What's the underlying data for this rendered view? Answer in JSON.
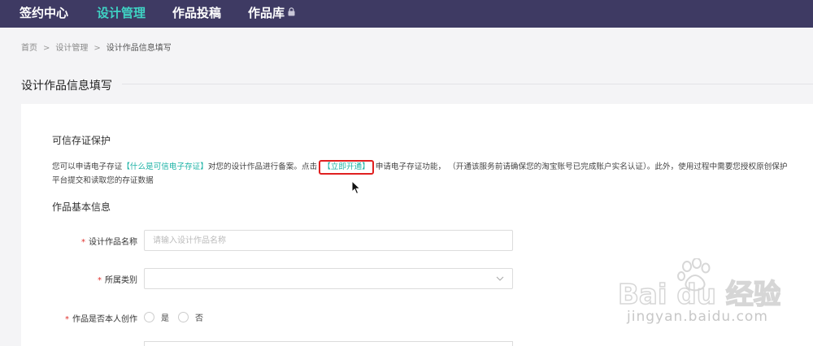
{
  "nav": {
    "items": [
      {
        "label": "签约中心"
      },
      {
        "label": "设计管理"
      },
      {
        "label": "作品投稿"
      },
      {
        "label": "作品库"
      }
    ]
  },
  "breadcrumb": {
    "items": [
      "首页",
      "设计管理",
      "设计作品信息填写"
    ],
    "separator": ">"
  },
  "page": {
    "title": "设计作品信息填写"
  },
  "trust": {
    "title": "可信存证保护",
    "text_1": "您可以申请电子存证",
    "link_what": "【什么是可信电子存证】",
    "text_2": "对您的设计作品进行备案。点击",
    "link_open": "【立即开通】",
    "text_3": "申请电子存证功能，  （开通该服务前请确保您的淘宝账号已完成账户实名认证）。此外，使用过程中需要您授权原创保护平台提交和读取您的存证数据"
  },
  "basic_info": {
    "title": "作品基本信息",
    "required_mark": "*",
    "name_label": "设计作品名称",
    "name_placeholder": "请输入设计作品名称",
    "name_value": "",
    "category_label": "所属类别",
    "category_value": "",
    "original_label": "作品是否本人创作",
    "original_options": [
      "是",
      "否"
    ]
  },
  "watermark": {
    "brand": "Bai du 经验",
    "url": "jingyan.baidu.com"
  },
  "colors": {
    "nav_bg": "#3e3a63",
    "accent": "#3fd3c4",
    "link": "#1db3a6",
    "highlight_box": "#e02020",
    "required": "#e0302c"
  },
  "icons": {
    "lock": "lock-icon",
    "select_arrow": "chevron-down-icon",
    "pointer": "mouse-cursor-icon"
  }
}
